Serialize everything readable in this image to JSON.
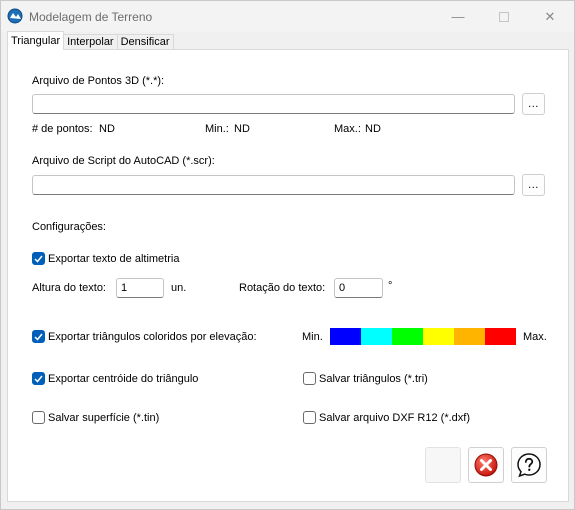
{
  "window": {
    "title": "Modelagem de Terreno",
    "minimize": "—",
    "close": "✕"
  },
  "tabs": [
    "Triangular",
    "Interpolar",
    "Densificar"
  ],
  "points_file": {
    "label": "Arquivo de Pontos 3D (*.*):",
    "value": "",
    "browse": "..."
  },
  "stats": {
    "count_label": "# de pontos:",
    "count_value": "ND",
    "min_label": "Min.:",
    "min_value": "ND",
    "max_label": "Max.:",
    "max_value": "ND"
  },
  "script_file": {
    "label": "Arquivo de Script do AutoCAD (*.scr):",
    "value": "",
    "browse": "..."
  },
  "config": {
    "heading": "Configurações:",
    "export_elevation_text": {
      "label": "Exportar texto de altimetria",
      "checked": true
    },
    "text_height": {
      "label": "Altura do texto:",
      "value": "1",
      "unit": "un."
    },
    "text_rotation": {
      "label": "Rotação do texto:",
      "value": "0",
      "unit": "°"
    },
    "export_colored_triangles": {
      "label": "Exportar triângulos coloridos por elevação:",
      "checked": true
    },
    "legend": {
      "min": "Min.",
      "max": "Max.",
      "colors": [
        "#0000ff",
        "#00ffff",
        "#00ff00",
        "#ffff00",
        "#ffb400",
        "#ff0000"
      ]
    },
    "export_centroid": {
      "label": "Exportar centróide do triângulo",
      "checked": true
    },
    "save_triangles": {
      "label": "Salvar triângulos (*.tri)",
      "checked": false
    },
    "save_surface": {
      "label": "Salvar superfície (*.tin)",
      "checked": false
    },
    "save_dxf": {
      "label": "Salvar arquivo DXF R12 (*.dxf)",
      "checked": false
    }
  },
  "actions": {
    "run_icon": "blank",
    "cancel_icon": "red-x-circle",
    "help_icon": "question-bubble"
  }
}
